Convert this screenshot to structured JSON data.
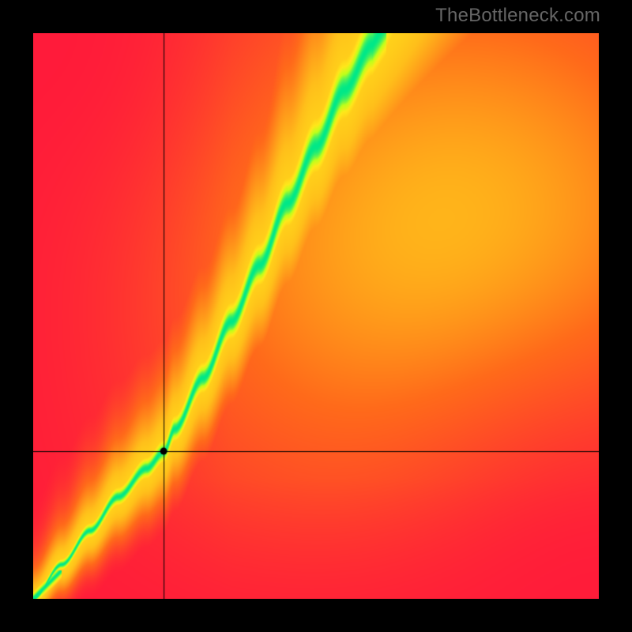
{
  "watermark": "TheBottleneck.com",
  "chart_data": {
    "type": "heatmap",
    "title": "",
    "xlabel": "",
    "ylabel": "",
    "xlim": [
      0,
      1
    ],
    "ylim": [
      0,
      1
    ],
    "crosshair": {
      "x": 0.231,
      "y": 0.74
    },
    "marker": {
      "x": 0.231,
      "y": 0.74
    },
    "ridge": {
      "description": "Optimal-match ridge (green) from bottom-left toward upper-center; steepens with x.",
      "points_xy": [
        [
          0.0,
          1.0
        ],
        [
          0.05,
          0.94
        ],
        [
          0.1,
          0.88
        ],
        [
          0.15,
          0.82
        ],
        [
          0.2,
          0.77
        ],
        [
          0.231,
          0.74
        ],
        [
          0.25,
          0.7
        ],
        [
          0.3,
          0.61
        ],
        [
          0.35,
          0.51
        ],
        [
          0.4,
          0.41
        ],
        [
          0.45,
          0.3
        ],
        [
          0.5,
          0.2
        ],
        [
          0.55,
          0.1
        ],
        [
          0.6,
          0.02
        ]
      ]
    },
    "colormap": {
      "stops": [
        {
          "t": 0.0,
          "hex": "#ff1a3a"
        },
        {
          "t": 0.35,
          "hex": "#ff6a1a"
        },
        {
          "t": 0.6,
          "hex": "#ffbf1a"
        },
        {
          "t": 0.8,
          "hex": "#ffe81a"
        },
        {
          "t": 0.9,
          "hex": "#c0ff1a"
        },
        {
          "t": 1.0,
          "hex": "#00e888"
        }
      ],
      "note": "t is normalized match score; 1.0 is on-ridge (green)."
    },
    "field": {
      "red_corners": [
        "top-left",
        "bottom-right"
      ],
      "orange_yellow_regions": [
        "right half broad plateau ~0.55 score",
        "band around ridge ~0.80-0.90"
      ],
      "green_region": "narrow band along ridge, widening at top"
    }
  }
}
